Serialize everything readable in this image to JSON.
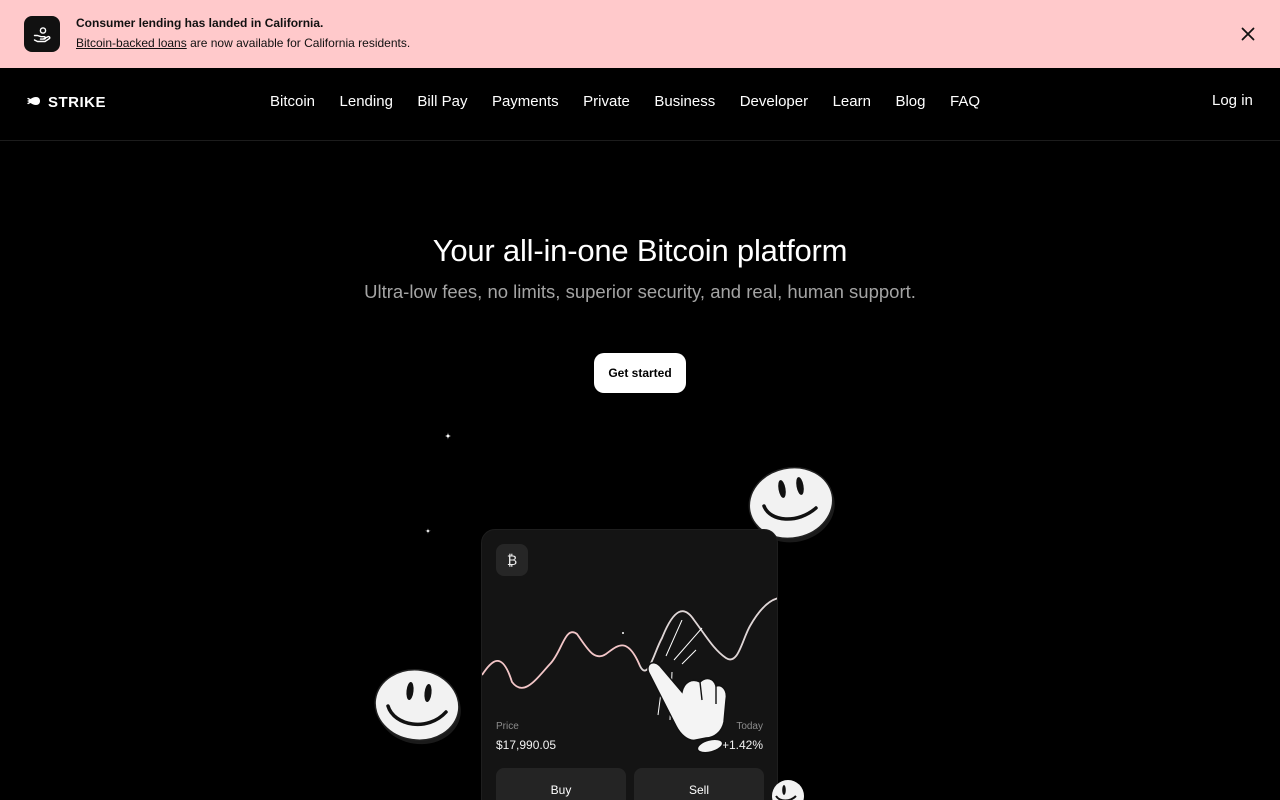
{
  "banner": {
    "icon": "hand-coin-icon",
    "title": "Consumer lending has landed in California.",
    "link_text": "Bitcoin-backed loans",
    "text_rest": " are now available for California residents.",
    "close_icon": "close-icon"
  },
  "nav": {
    "logo_text": "STRIKE",
    "links": [
      "Bitcoin",
      "Lending",
      "Bill Pay",
      "Payments",
      "Private",
      "Business",
      "Developer",
      "Learn",
      "Blog",
      "FAQ"
    ],
    "login": "Log in"
  },
  "hero": {
    "title": "Your all-in-one Bitcoin platform",
    "subtitle": "Ultra-low fees, no limits, superior security, and real, human support.",
    "cta": "Get started"
  },
  "card": {
    "badge": "₿",
    "price_label": "Price",
    "price_value": "$17,990.05",
    "today_label": "Today",
    "today_value": "+1.42%",
    "buy": "Buy",
    "sell": "Sell"
  },
  "colors": {
    "banner_bg": "#ffc9cb",
    "background": "#000000",
    "chart_line": "#f3c6c8"
  }
}
